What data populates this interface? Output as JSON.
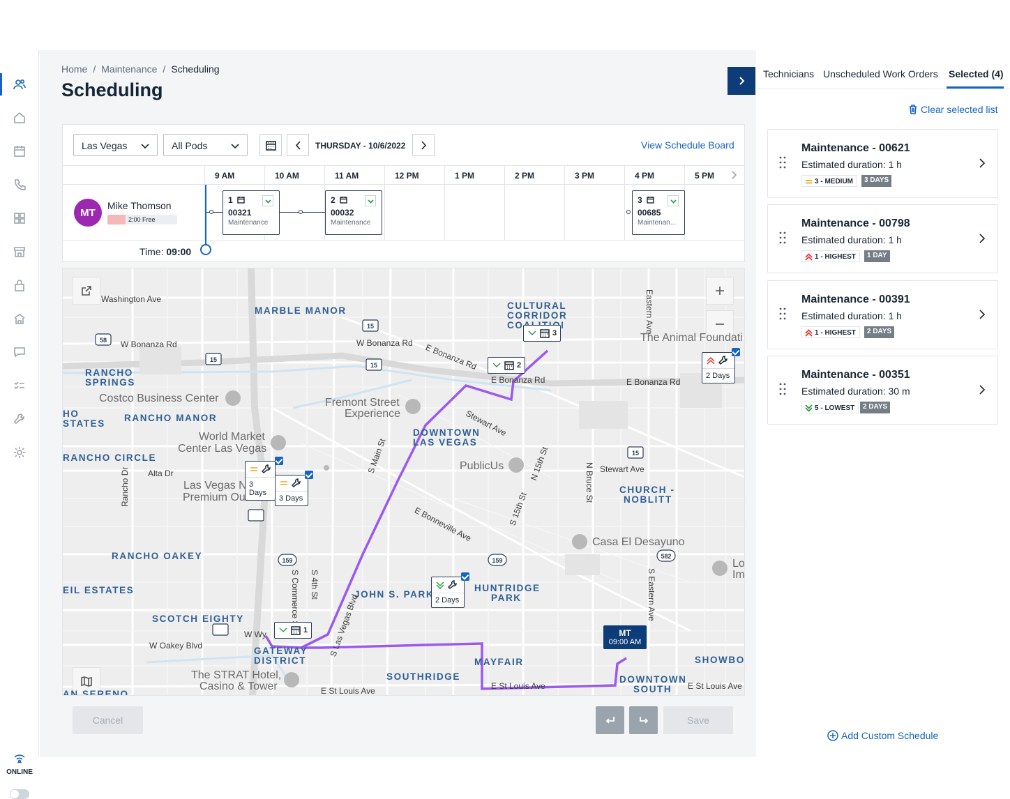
{
  "breadcrumb": {
    "home": "Home",
    "maintenance": "Maintenance",
    "current": "Scheduling"
  },
  "page_title": "Scheduling",
  "filters": {
    "location": "Las Vegas",
    "pods": "All Pods",
    "date": "THURSDAY - 10/6/2022",
    "view_board": "View Schedule Board"
  },
  "hours": [
    "9 AM",
    "10 AM",
    "11 AM",
    "12 PM",
    "1 PM",
    "2 PM",
    "3 PM",
    "4 PM",
    "5 PM"
  ],
  "technician": {
    "initials": "MT",
    "name": "Mike Thomson",
    "free": "2:00 Free",
    "time_label": "Time:",
    "time_value": "09:00"
  },
  "work_orders": [
    {
      "num": "1",
      "id": "00321",
      "type": "Maintenance"
    },
    {
      "num": "2",
      "id": "00032",
      "type": "Maintenance"
    },
    {
      "num": "3",
      "id": "00685",
      "type": "Maintenan..."
    }
  ],
  "map": {
    "areas": [
      "MARBLE MANOR",
      "CULTURAL",
      "CORRIDOR",
      "COALITION",
      "RANCHO",
      "SPRINGS",
      "RANCHO MANOR",
      "HO",
      "STATES",
      "RANCHO CIRCLE",
      "DOWNTOWN",
      "LAS VEGAS",
      "CHURCH -",
      "NOBLITT",
      "RANCHO OAKEY",
      "EIL ESTATES",
      "JOHN S. PARK",
      "HUNTRIDGE",
      "PARK",
      "SCOTCH EIGHTY",
      "GATEWAY",
      "DISTRICT",
      "SOUTHRIDGE",
      "MAYFAIR",
      "SHOWBOA",
      "DOWNTOWN",
      "SOUTH",
      "AN   SERENO"
    ],
    "streets": [
      "Washington Ave",
      "W Bonanza Rd",
      "W Bonanza Rd",
      "E Bonanza Rd",
      "E Bonanza Rd",
      "E Bonanza Rd",
      "Stewart Ave",
      "Stewart Ave",
      "Alta Dr",
      "E Bonneville Ave",
      "W Oakey Blvd",
      "E St Louis Ave",
      "E St Louis Ave",
      "E St Louis Ave",
      "Eastern Ave",
      "S Main St",
      "S Las Vegas Blvd",
      "N 15th St",
      "S 15th St",
      "N Bruce St",
      "Rancho Dr",
      "S Commerce St",
      "S 4th St",
      "S Eastern Ave",
      "W Wy"
    ],
    "pois": [
      "The Animal Foundati",
      "Costco Business Center",
      "Fremont Street",
      "Experience",
      "World Market",
      "Center Las Vegas",
      "PublicUs",
      "Las Vegas N",
      "Premium Ou",
      "Casa El Desayuno",
      "Lo",
      "Im",
      "The STRAT Hotel,",
      "Casino & Tower"
    ],
    "shields": [
      "15",
      "15",
      "15",
      "15",
      "159",
      "159",
      "582",
      "58"
    ],
    "route_stops": [
      "1",
      "2",
      "3"
    ],
    "pins": [
      "2 Days",
      "3 Days",
      "3 Days",
      "2 Days"
    ],
    "mt_pin": {
      "initials": "MT",
      "time": "09:00 AM"
    }
  },
  "actions": {
    "cancel": "Cancel",
    "save": "Save"
  },
  "panel": {
    "tabs": [
      "Technicians",
      "Unscheduled Work Orders",
      "Selected (4)"
    ],
    "clear": "Clear selected list",
    "add": "Add Custom Schedule",
    "items": [
      {
        "title": "Maintenance - 00621",
        "duration": "Estimated duration: 1 h",
        "priority": "3 - MEDIUM",
        "days": "3 DAYS"
      },
      {
        "title": "Maintenance - 00798",
        "duration": "Estimated duration: 1 h",
        "priority": "1 - HIGHEST",
        "days": "1 DAY"
      },
      {
        "title": "Maintenance - 00391",
        "duration": "Estimated duration: 1 h",
        "priority": "1 - HIGHEST",
        "days": "2 DAYS"
      },
      {
        "title": "Maintenance - 00351",
        "duration": "Estimated duration: 30 m",
        "priority": "5 - LOWEST",
        "days": "2 DAYS"
      }
    ]
  },
  "status": {
    "online": "ONLINE"
  },
  "colors": {
    "primary": "#1565c0",
    "navy": "#0d3c78",
    "route": "#9b59f0",
    "avatar": "#9c27b0"
  }
}
